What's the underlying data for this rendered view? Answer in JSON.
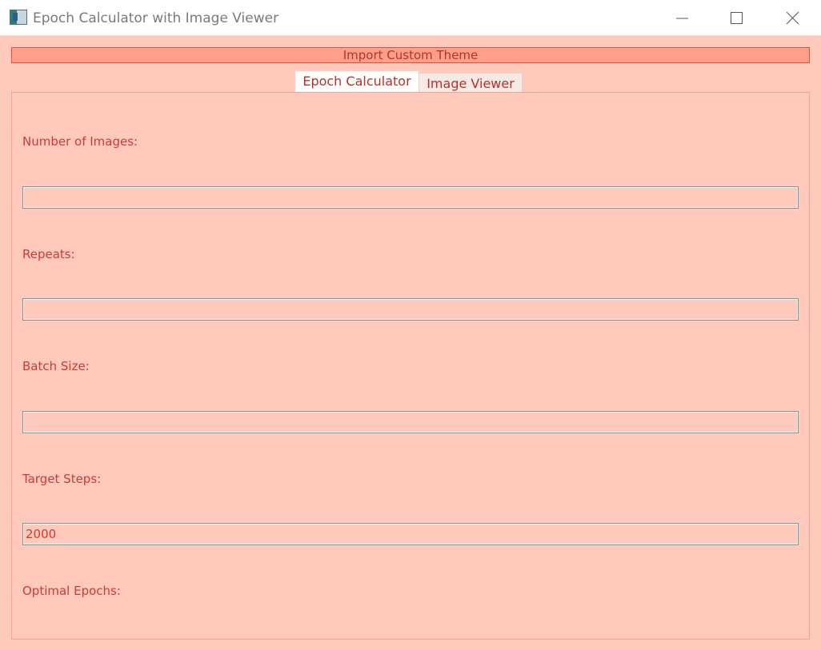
{
  "window": {
    "title": "Epoch Calculator with Image Viewer",
    "icon": "app-icon"
  },
  "theme_button": {
    "label": "Import Custom Theme"
  },
  "tabs": [
    {
      "label": "Epoch Calculator",
      "active": true
    },
    {
      "label": "Image Viewer",
      "active": false
    }
  ],
  "form": {
    "fields": [
      {
        "label": "Number of Images:",
        "value": ""
      },
      {
        "label": "Repeats:",
        "value": ""
      },
      {
        "label": "Batch Size:",
        "value": ""
      },
      {
        "label": "Target Steps:",
        "value": "2000"
      }
    ],
    "result_label": "Optimal Epochs:"
  },
  "colors": {
    "background": "#ffcabb",
    "accent_text": "#cc3a35",
    "button_fill": "#ff9f8a",
    "button_border": "#e0533f"
  }
}
